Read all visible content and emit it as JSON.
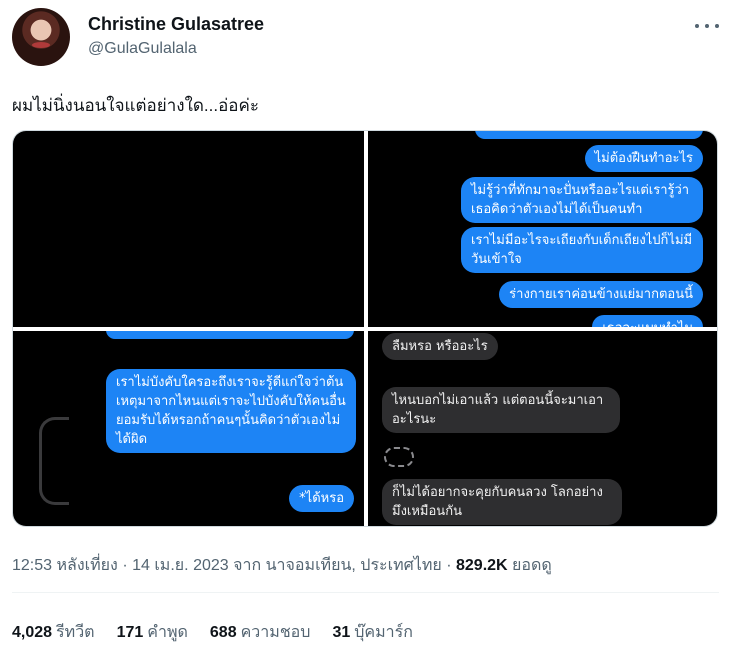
{
  "author": {
    "name": "Christine Gulasatree",
    "handle": "@GulaGulalala"
  },
  "tweet": {
    "text": "ผมไม่นิ่งนอนใจแต่อย่างใด...อ่อค่ะ"
  },
  "media": {
    "panel2": {
      "b1": "ไม่ต้องฝืนทำอะไร",
      "b2": "ไม่รู้ว่าที่ทักมาจะปั่นหรืออะไรแต่เรารู้ว่าเธอคิดว่าตัวเองไม่ได้เป็นคนทำ",
      "b3": "เราไม่มีอะไรจะเถียงกับเด็กเถียงไปก็ไม่มีวันเข้าใจ",
      "b4": "ร่างกายเราค่อนข้างแย่มากตอนนี้",
      "b5": "เธอจะแบบทำไม"
    },
    "panel3": {
      "b7": "เราไม่บังคับใครอะถึงเราจะรู้ดีแก่ใจว่าต้นเหตุมาจากไหนแต่เราจะไปบังคับให้คนอื่นยอมรับได้หรอกถ้าคนๆนั้นคิดว่าตัวเองไม่ได้ผิด",
      "b8": "*ได้หรอ"
    },
    "panel4": {
      "g1": "ลืมหรอ หรืออะไร",
      "g2": "ไหนบอกไม่เอาแล้ว แต่ตอนนี้จะมาเอาอะไรนะ",
      "g3": "ก็ไม่ได้อยากจะคุยกับคนลวง โลกอย่างมึงเหมือนกัน"
    },
    "colors": {
      "sent": "#1d84f5",
      "received": "#2e2e30",
      "background": "#000000"
    }
  },
  "meta": {
    "time": "12:53 หลังเที่ยง",
    "date": "14 เม.ย. 2023",
    "from_label": "จาก",
    "location": "นาจอมเทียน, ประเทศไทย",
    "views_count": "829.2K",
    "views_label": "ยอดดู",
    "separator": "·"
  },
  "stats": {
    "retweets_count": "4,028",
    "retweets_label": "รีทวีต",
    "quotes_count": "171",
    "quotes_label": "คำพูด",
    "likes_count": "688",
    "likes_label": "ความชอบ",
    "bookmarks_count": "31",
    "bookmarks_label": "บุ๊คมาร์ก"
  },
  "icons": {
    "more": "more-horizontal-icon"
  }
}
